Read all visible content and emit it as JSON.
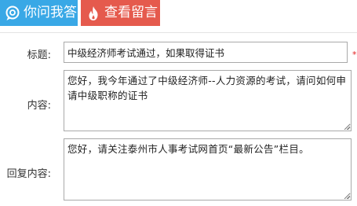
{
  "tabs": [
    {
      "label": "你问我答",
      "icon": "question-bubble-icon",
      "color": "#39a8e6"
    },
    {
      "label": "查看留言",
      "icon": "flame-icon",
      "color": "#e55a4d"
    }
  ],
  "form": {
    "title_label": "标题:",
    "title_value": "中级经济师考试通过，如果取得证书",
    "required_mark": "*",
    "content_label": "内容:",
    "content_value": "您好，我今年通过了中级经济师--人力资源的考试，请问如何申请中级职称的证书",
    "reply_label": "回复内容:",
    "reply_value": "您好，请关注泰州市人事考试网首页“最新公告”栏目。"
  }
}
